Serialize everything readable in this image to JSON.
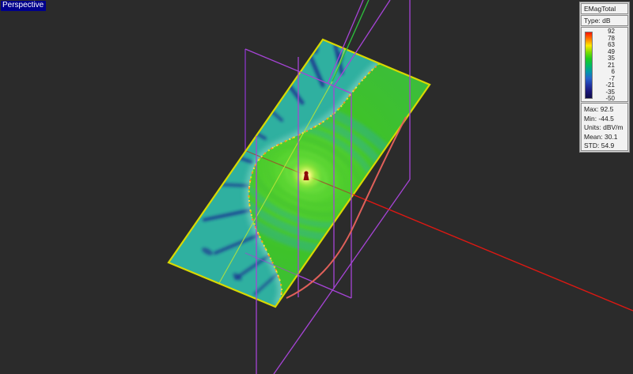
{
  "viewport": {
    "view_label": "Perspective"
  },
  "legend": {
    "title": "EMagTotal",
    "type_label": "Type: dB",
    "ticks": [
      "92",
      "78",
      "63",
      "49",
      "35",
      "21",
      "6",
      "-7",
      "-21",
      "-35",
      "-50"
    ],
    "stats": [
      "Max: 92.5",
      "Min: -44.5",
      "Units: dBV/m",
      "Mean: 30.1",
      "STD: 54.9"
    ]
  },
  "colorbar_gradient": [
    "#ff1400",
    "#ff7a00",
    "#ffe800",
    "#7edd00",
    "#1ecc1e",
    "#00bb60",
    "#0098a8",
    "#2663cc",
    "#2136a6",
    "#1a1678",
    "#0e0c48"
  ],
  "colors": {
    "background": "#2b2b2b",
    "label_bg": "#00008b",
    "label_fg": "#ffffff",
    "text": "#1a1a1a",
    "plane_border": "#d8d800",
    "field_teal": "#2fb0a0",
    "field_green": "#3ec22a",
    "field_null_navy": "#1a2d90",
    "wireframe_back": "#8a35c8",
    "wireframe_front": "#a644d6",
    "axis_red": "#de1812",
    "arc_red": "#e0605a",
    "line_green": "#2dbb3c",
    "ray_lime": "#b8e438",
    "focus_marker": "#8c0d08",
    "focus_glow": "#ffffd0"
  }
}
